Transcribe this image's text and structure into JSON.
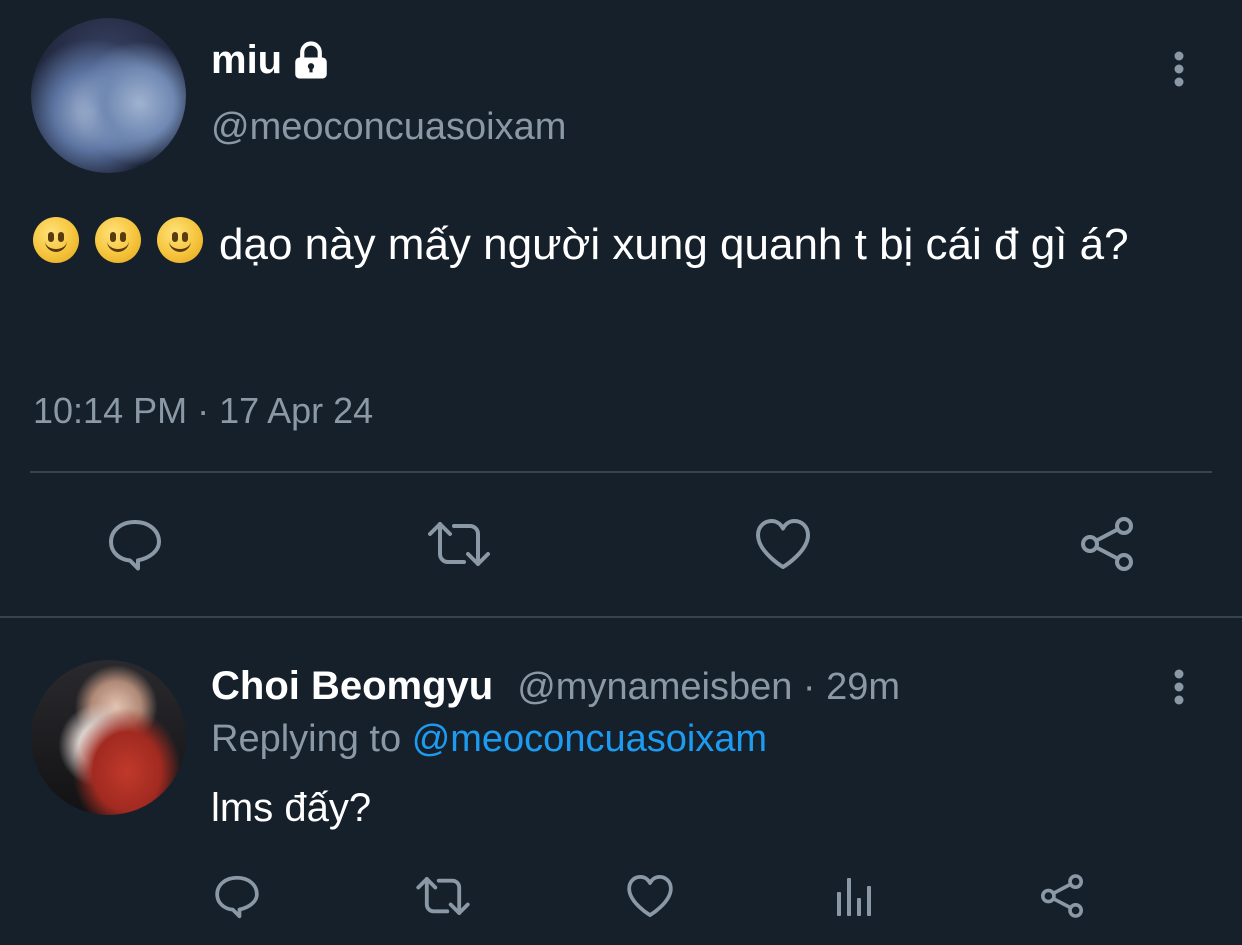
{
  "tweet": {
    "display_name": "miu",
    "handle": "@meoconcuasoixam",
    "text": "dạo này mấy người xung quanh t bị cái đ gì á?",
    "emoji_count": 3,
    "timestamp": "10:14 PM · 17 Apr 24",
    "icons": {
      "locked": "lock-icon",
      "more": "more-vertical-icon",
      "reply": "comment-icon",
      "retweet": "retweet-icon",
      "like": "heart-icon",
      "share": "share-icon"
    }
  },
  "reply": {
    "display_name": "Choi Beomgyu",
    "handle_time": "@mynameisben · 29m",
    "replying_prefix": "Replying to",
    "replying_to": "@meoconcuasoixam",
    "text": "lms đấy?",
    "icons": {
      "more": "more-vertical-icon",
      "reply": "comment-icon",
      "retweet": "retweet-icon",
      "like": "heart-icon",
      "analytics": "analytics-icon",
      "share": "share-icon"
    }
  },
  "colors": {
    "background": "#15202b",
    "secondary_text": "#8b98a5",
    "link": "#1d9bf0",
    "divider": "#38444d"
  }
}
